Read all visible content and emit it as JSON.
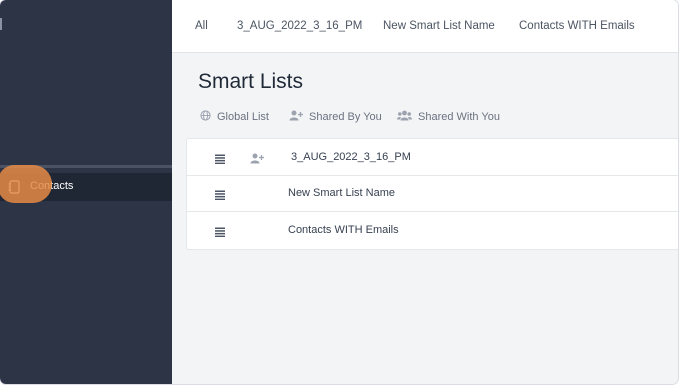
{
  "sidebar": {
    "items": [
      {
        "label": "Contacts",
        "icon": "contacts-book-icon"
      }
    ]
  },
  "tabs": [
    {
      "label": "All"
    },
    {
      "label": "3_AUG_2022_3_16_PM"
    },
    {
      "label": "New Smart List Name"
    },
    {
      "label": "Contacts WITH Emails"
    }
  ],
  "page": {
    "title": "Smart Lists"
  },
  "filters": [
    {
      "label": "Global List",
      "icon": "globe-icon"
    },
    {
      "label": "Shared By You",
      "icon": "user-plus-icon"
    },
    {
      "label": "Shared With You",
      "icon": "users-icon"
    }
  ],
  "lists": [
    {
      "name": "3_AUG_2022_3_16_PM",
      "shared_icon": "user-plus-icon"
    },
    {
      "name": "New Smart List Name"
    },
    {
      "name": "Contacts WITH Emails"
    }
  ],
  "colors": {
    "sidebar_bg": "#2d3446",
    "sidebar_active_bg": "#1f2634",
    "highlight": "#e68c46",
    "main_bg": "#f3f4f6"
  }
}
